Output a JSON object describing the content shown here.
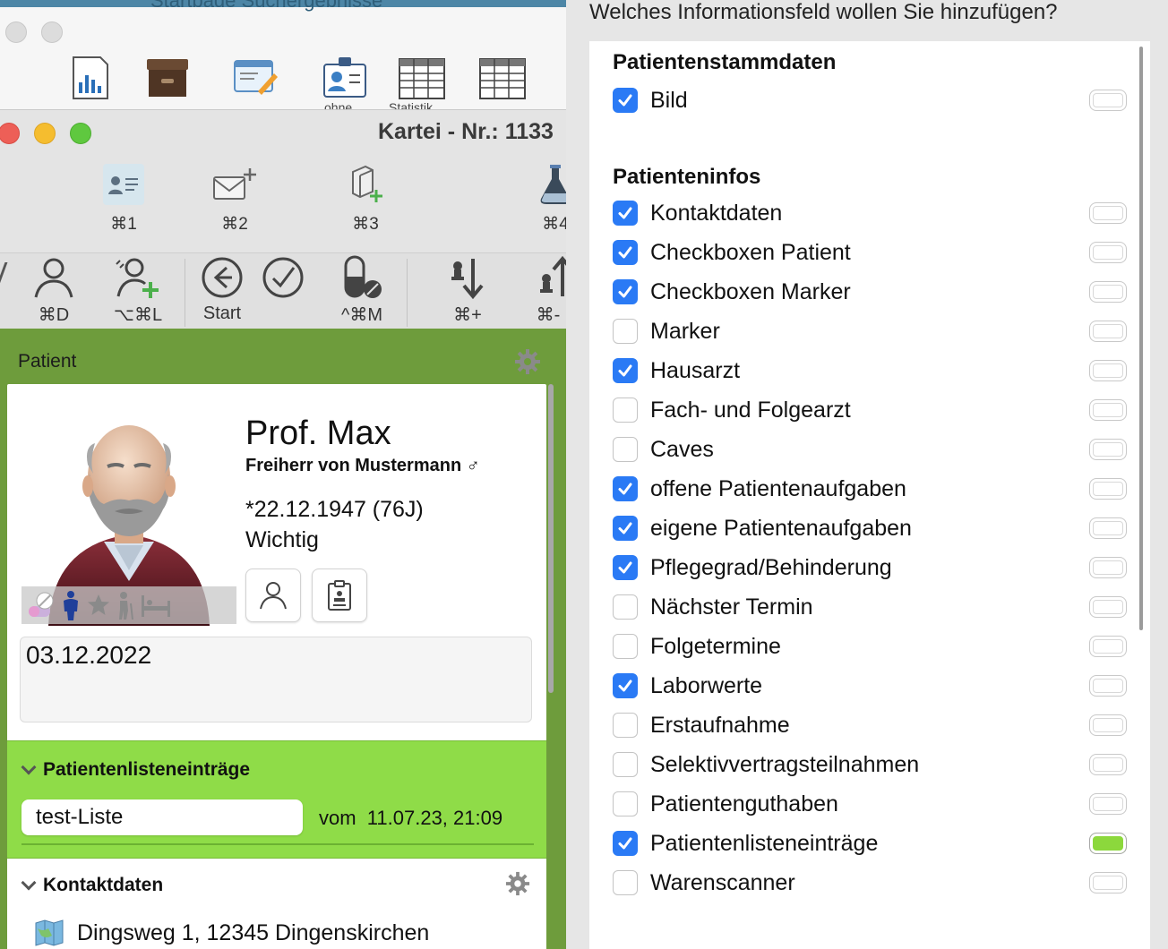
{
  "background_window": {
    "title_fragment": "Startbade Suchergebnisse",
    "icon_captions": [
      "ohne",
      "Statistik"
    ]
  },
  "kartei": {
    "title": "Kartei - Nr.: 1133",
    "tabs": [
      {
        "label": "⌘1",
        "icon": "patient-card-icon"
      },
      {
        "label": "⌘2",
        "icon": "mail-add-icon"
      },
      {
        "label": "⌘3",
        "icon": "document-add-icon"
      },
      {
        "label": "⌘4",
        "icon": "flask-icon"
      }
    ],
    "toolbar": [
      {
        "label": "⌘D",
        "icon": "person-icon"
      },
      {
        "label": "⌥⌘L",
        "icon": "person-add-icon"
      },
      {
        "label": "Start",
        "icon": "back-arrow-icon"
      },
      {
        "label": "",
        "icon": "check-circle-icon"
      },
      {
        "label": "^⌘M",
        "icon": "pill-icon"
      },
      {
        "label": "⌘+",
        "icon": "sort-down-icon"
      },
      {
        "label": "⌘-",
        "icon": "sort-up-icon"
      }
    ],
    "section_label": "Patient",
    "patient": {
      "name": "Prof. Max",
      "subname": "Freiherr von Mustermann ♂",
      "dob": "*22.12.1947 (76J)",
      "note": "Wichtig",
      "date_field": "03.12.2022"
    },
    "patient_list": {
      "heading": "Patientenlisteneinträge",
      "entry": "test-Liste",
      "vom_label": "vom",
      "vom_value": "11.07.23, 21:09"
    },
    "contact": {
      "heading": "Kontaktdaten",
      "address": "Dingsweg 1, 12345 Dingenskirchen"
    }
  },
  "popover": {
    "question": "Welches Informationsfeld wollen Sie hinzufügen?",
    "groups": [
      {
        "title": "Patientenstammdaten",
        "items": [
          {
            "label": "Bild",
            "checked": true,
            "pill": false
          }
        ]
      },
      {
        "title": "Patienteninfos",
        "items": [
          {
            "label": "Kontaktdaten",
            "checked": true,
            "pill": false
          },
          {
            "label": "Checkboxen Patient",
            "checked": true,
            "pill": false
          },
          {
            "label": "Checkboxen Marker",
            "checked": true,
            "pill": false
          },
          {
            "label": "Marker",
            "checked": false,
            "pill": false
          },
          {
            "label": "Hausarzt",
            "checked": true,
            "pill": false
          },
          {
            "label": "Fach- und Folgearzt",
            "checked": false,
            "pill": false
          },
          {
            "label": "Caves",
            "checked": false,
            "pill": false
          },
          {
            "label": "offene Patientenaufgaben",
            "checked": true,
            "pill": false
          },
          {
            "label": "eigene Patientenaufgaben",
            "checked": true,
            "pill": false
          },
          {
            "label": "Pflegegrad/Behinderung",
            "checked": true,
            "pill": false
          },
          {
            "label": "Nächster Termin",
            "checked": false,
            "pill": false
          },
          {
            "label": "Folgetermine",
            "checked": false,
            "pill": false
          },
          {
            "label": "Laborwerte",
            "checked": true,
            "pill": false
          },
          {
            "label": "Erstaufnahme",
            "checked": false,
            "pill": false
          },
          {
            "label": "Selektivvertragsteilnahmen",
            "checked": false,
            "pill": false
          },
          {
            "label": "Patientenguthaben",
            "checked": false,
            "pill": false
          },
          {
            "label": "Patientenlisteneinträge",
            "checked": true,
            "pill": true
          },
          {
            "label": "Warenscanner",
            "checked": false,
            "pill": false
          }
        ]
      }
    ],
    "colors": {
      "checkbox_on": "#2a7af5",
      "pill_on": "#8cd83c",
      "section_green": "#8fdc48",
      "header_green": "#6e9c3c"
    }
  }
}
